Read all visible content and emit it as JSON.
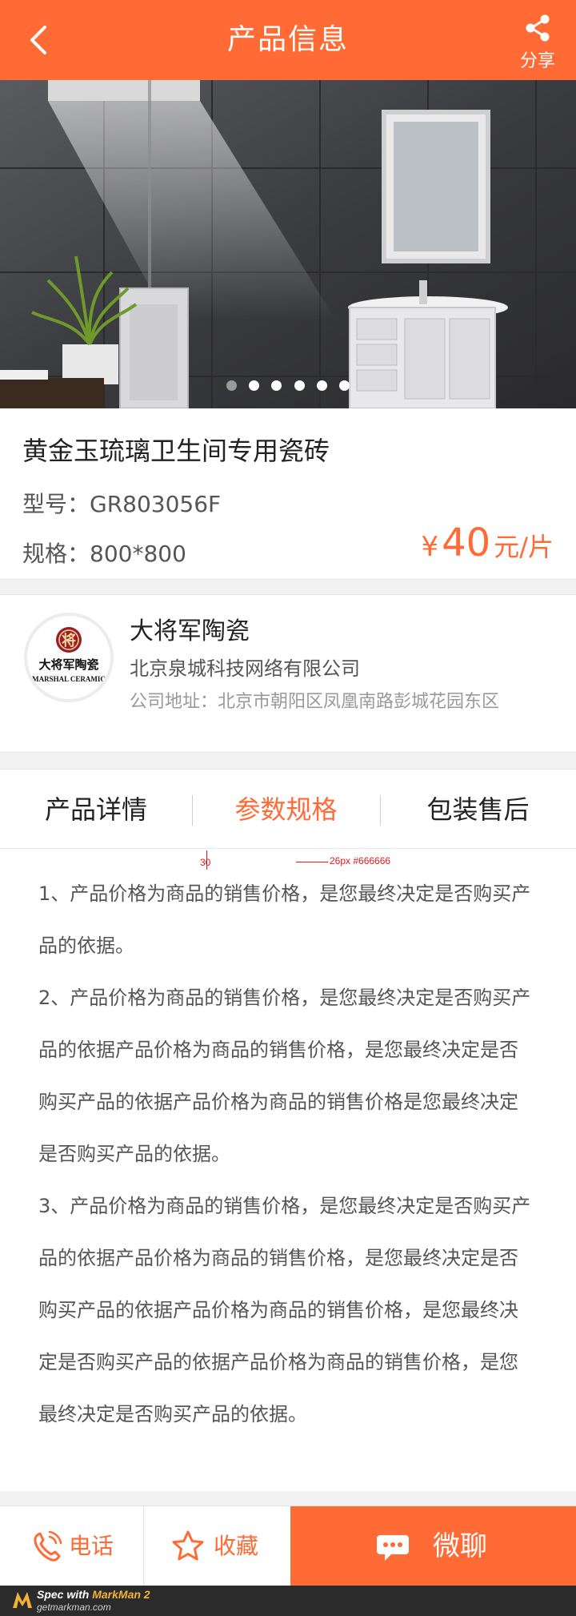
{
  "header": {
    "title": "产品信息",
    "share_label": "分享",
    "background": "#ff6a35"
  },
  "banner": {
    "image": "bathroom-vanity-photo",
    "slide_count": 6,
    "active_index": 0
  },
  "product": {
    "name": "黄金玉琉璃卫生间专用瓷砖",
    "model": "型号：GR803056F",
    "spec": "规格：800*800",
    "price_symbol": "¥",
    "price_value": "40",
    "price_unit": "元/片"
  },
  "company": {
    "name": "大将军陶瓷",
    "legal_name": "北京泉城科技网络有限公司",
    "address": "公司地址：北京市朝阳区凤凰南路彭城花园东区",
    "logo_text": "大将军陶瓷",
    "logo_subtext": "MARSHAL CERAMIC",
    "logo_seal": "将"
  },
  "tabs": [
    {
      "label": "产品详情",
      "active": false
    },
    {
      "label": "参数规格",
      "active": true
    },
    {
      "label": "包装售后",
      "active": false
    }
  ],
  "content": {
    "paragraphs": [
      "1、产品价格为商品的销售价格，是您最终决定是否购买产品的依据。",
      "2、产品价格为商品的销售价格，是您最终决定是否购买产品的依据产品价格为商品的销售价格，是您最终决定是否购买产品的依据产品价格为商品的销售价格是您最终决定是否购买产品的依据。",
      "3、产品价格为商品的销售价格，是您最终决定是否购买产品的依据产品价格为商品的销售价格，是您最终决定是否购买产品的依据产品价格为商品的销售价格，是您最终决定是否购买产品的依据产品价格为商品的销售价格，是您最终决定是否购买产品的依据。"
    ],
    "annotation_spacing": "30",
    "annotation_font": "26px  #666666"
  },
  "bottom_bar": {
    "call_label": "电话",
    "favorite_label": "收藏",
    "chat_label": "微聊",
    "accent": "#ff6a35"
  },
  "footer": {
    "brand_prefix": "Spec with ",
    "brand_name": "MarkMan 2",
    "url": "getmarkman.com"
  }
}
